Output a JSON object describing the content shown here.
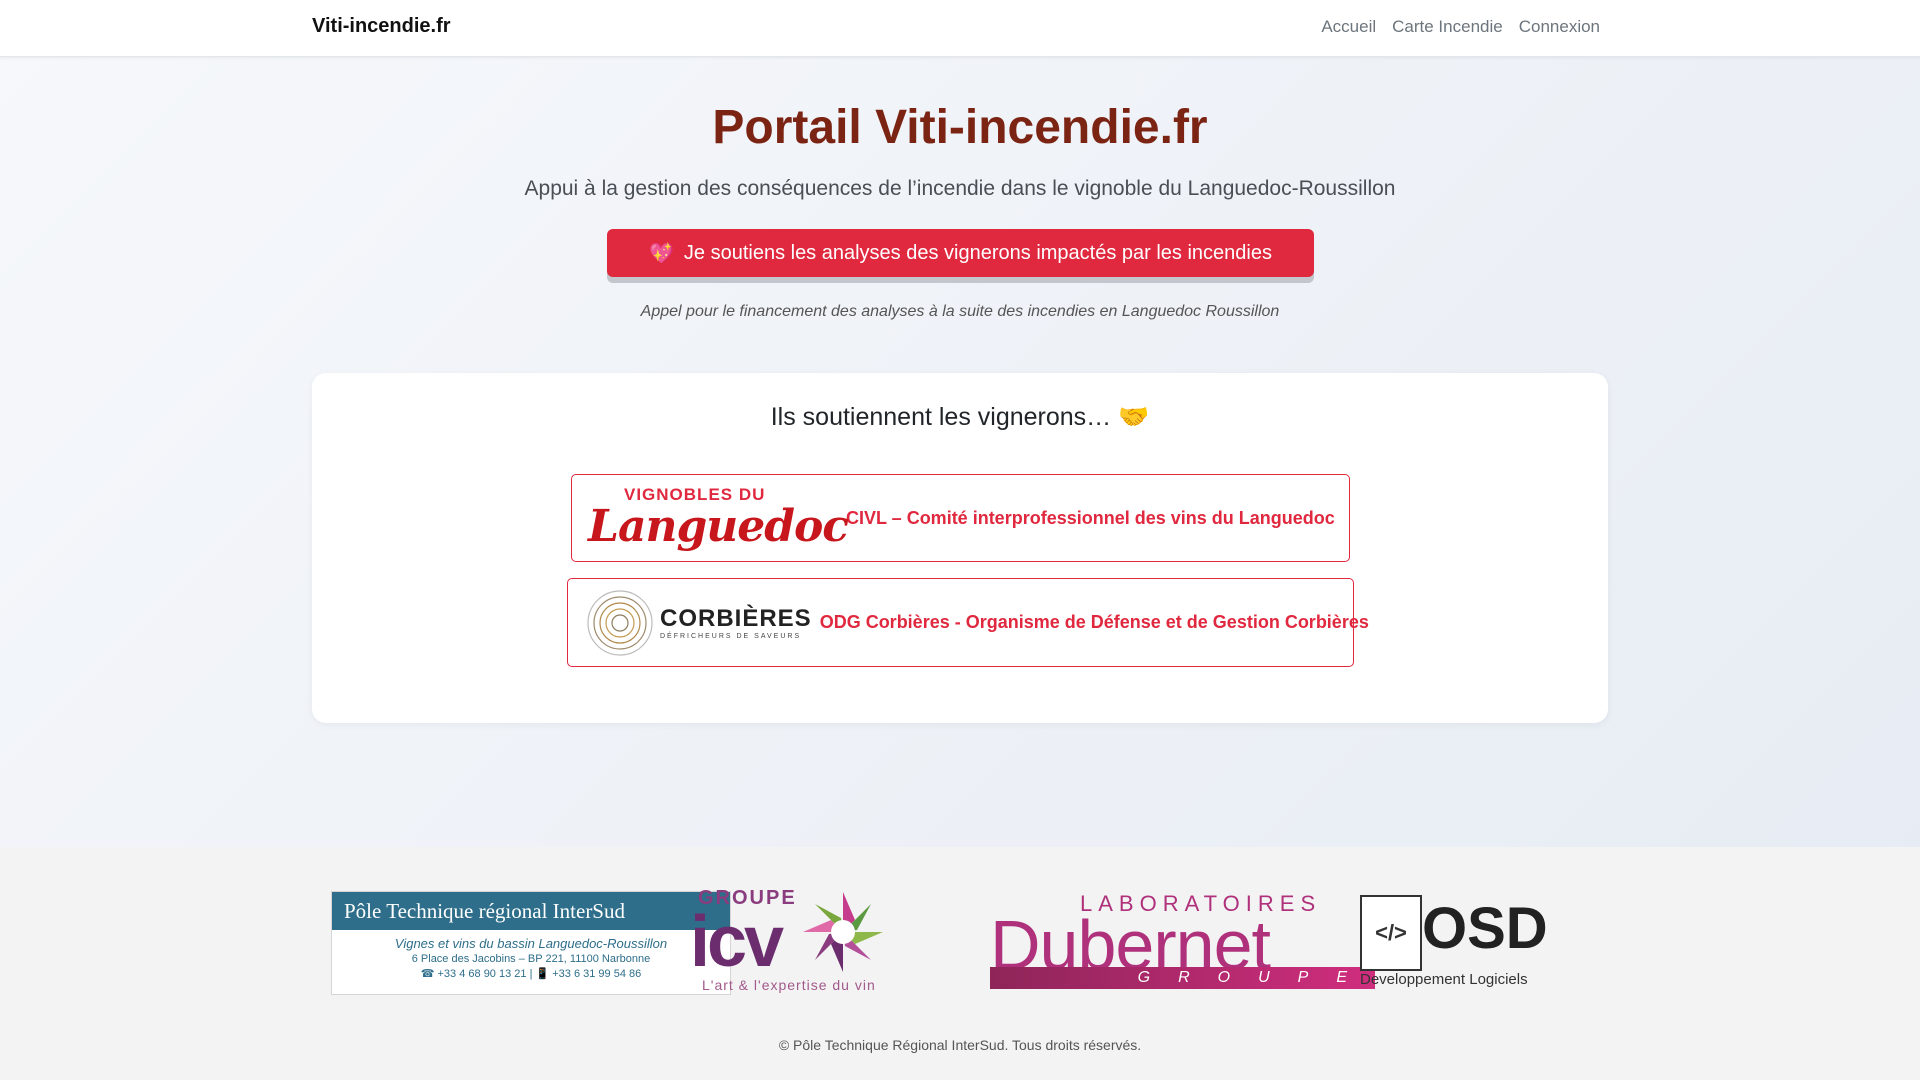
{
  "navbar": {
    "brand": "Viti-incendie.fr",
    "links": [
      "Accueil",
      "Carte Incendie",
      "Connexion"
    ]
  },
  "hero": {
    "title": "Portail Viti-incendie.fr",
    "subtitle": "Appui à la gestion des conséquences de l’incendie dans le vignoble du Languedoc-Roussillon",
    "button_icon": "heart-icon",
    "button_label": "Je soutiens les analyses des vignerons impactés par les incendies",
    "appeal": "Appel pour le financement des analyses à la suite des incendies en Languedoc Roussillon"
  },
  "supporters": {
    "title": "Ils soutiennent les vignerons… 🤝",
    "items": [
      {
        "logo_small": "VIGNOBLES DU",
        "logo_big": "Languedoc",
        "name": "CIVL – Comité interprofessionnel des vins du Languedoc"
      },
      {
        "logo_name": "CORBIÈRES",
        "logo_tag": "DÉFRICHEURS DE SAVEURS",
        "name": "ODG Corbières - Organisme de Défense et de Gestion Corbières"
      }
    ]
  },
  "footer": {
    "ptr": {
      "title": "Pôle Technique régional InterSud",
      "line1": "Vignes et vins du bassin Languedoc-Roussillon",
      "line2": "6 Place des Jacobins – BP 221, 11100 Narbonne",
      "line3": "☎ +33 4 68 90 13 21 | 📱 +33 6 31 99 54 86"
    },
    "icv": {
      "group": "GROUPE",
      "name": "icv",
      "tagline": "L'art & l'expertise du vin"
    },
    "dubernet": {
      "lab": "LABORATOIRES",
      "name": "Dubernet",
      "group": "GROUPE"
    },
    "osd": {
      "icon": "</>",
      "name": "OSD",
      "sub": "Developpement Logiciels"
    },
    "copyright": "© Pôle Technique Régional InterSud. Tous droits réservés."
  },
  "colors": {
    "accent": "#e0283f",
    "title": "#7b2414",
    "ptr_blue": "#2e6e8a",
    "dubernet_pink": "#b0317b"
  }
}
